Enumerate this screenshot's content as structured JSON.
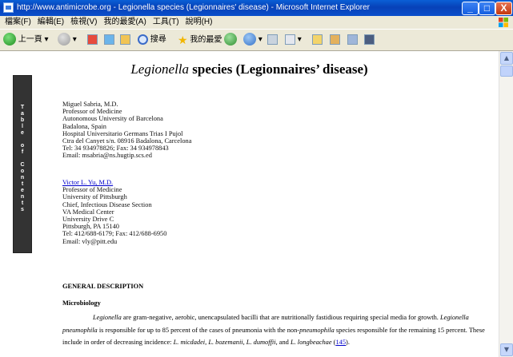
{
  "window": {
    "title": "http://www.antimicrobe.org - Legionella species (Legionnaires'   disease) - Microsoft Internet Explorer",
    "minimize": "_",
    "maximize": "□",
    "close": "X"
  },
  "menu": {
    "items": [
      "檔案(F)",
      "編輯(E)",
      "檢視(V)",
      "我的最愛(A)",
      "工具(T)",
      "說明(H)"
    ]
  },
  "toolbar": {
    "back_label": "上一頁",
    "search_label": "搜尋",
    "favorites_label": "我的最愛"
  },
  "page": {
    "heading_italic": "Legionella",
    "heading_rest": " species (Legionnaires’ disease)",
    "toc_letters": [
      "T",
      "a",
      "b",
      "l",
      "e",
      "",
      "o",
      "f",
      "",
      "C",
      "o",
      "n",
      "t",
      "e",
      "n",
      "t",
      "s"
    ],
    "author1": [
      "Miguel Sabria, M.D.",
      "Professor of Medicine",
      "Autonomous University of Barcelona",
      "Badalona, Spain",
      "Hospital Universitario Germans Trias I Pujol",
      "Ctra del Canyet s/n. 08916 Badalona, Carcelona",
      "Tel: 34 934978826; Fax: 34 934978843",
      "Email: msabria@ns.hugtip.scs.ed"
    ],
    "author2_name": "Victor L. Yu, M.D.",
    "author2": [
      "Professor of Medicine",
      "University of Pittsburgh",
      "Chief, Infectious Disease Section",
      "VA Medical Center",
      "University Drive C",
      "Pittsburgh, PA 15140",
      "Tel: 412/688-6179; Fax: 412/688-6950",
      "Email:  vly@pitt.edu"
    ],
    "section1": "GENERAL DESCRIPTION",
    "section2": "Microbiology",
    "para": {
      "t1": "Legionella",
      "t2": " are gram-negative, aerobic, unencapsulated bacilli that are nutritionally fastidious requiring special media for growth. ",
      "t3": "Legionella pneumophila",
      "t4": " is responsible for up to 85 percent of the cases of pneumonia with the non-",
      "t5": "pneumophila",
      "t6": " species responsible for the remaining 15 percent. These include in order of decreasing incidence: ",
      "t7": "L. micdadei, L. bozemanii, L. dumoffii",
      "t8": ", and ",
      "t9": "L. longbeachae",
      "t10": " (",
      "ref": "145",
      "t11": ")."
    }
  }
}
